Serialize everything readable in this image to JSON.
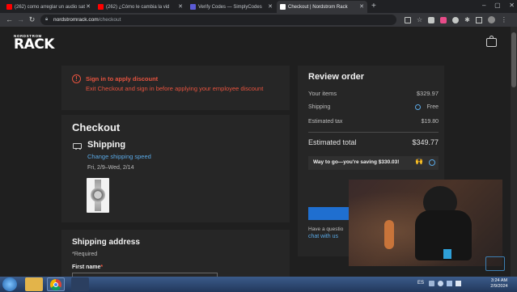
{
  "browser": {
    "tabs": [
      {
        "title": "(262) como arreglar un audio sat",
        "favicon_color": "#ff0000"
      },
      {
        "title": "(262) ¿Cómo le cambia la vid",
        "favicon_color": "#ff0000"
      },
      {
        "title": "Verify Codes — SimplyCodes",
        "favicon_color": "#5b5bd6"
      },
      {
        "title": "Checkout | Nordstrom Rack",
        "favicon_color": "#ffffff"
      }
    ],
    "url_host": "nordstromrack.com",
    "url_path": "/checkout",
    "new_tab_label": "+"
  },
  "header": {
    "logo_small": "NORDSTROM",
    "logo_big": "RACK"
  },
  "discount_notice": {
    "title": "Sign in to apply discount",
    "body": "Exit Checkout and sign in before applying your employee discount"
  },
  "checkout": {
    "heading": "Checkout",
    "shipping_title": "Shipping",
    "change_speed_link": "Change shipping speed",
    "delivery_window": "Fri, 2/9–Wed, 2/14"
  },
  "shipping_address": {
    "heading": "Shipping address",
    "required_note": "*Required",
    "first_name_label": "First name",
    "required_mark": "*"
  },
  "review": {
    "heading": "Review order",
    "items_label": "Your items",
    "items_value": "$329.97",
    "shipping_label": "Shipping",
    "shipping_value": "Free",
    "tax_label": "Estimated tax",
    "tax_value": "$19.80",
    "total_label": "Estimated total",
    "total_value": "$349.77",
    "savings_text": "Way to go—you're saving $330.03!",
    "savings_emoji": "🙌",
    "help_text": "Have a questio",
    "chat_link": "chat with us"
  },
  "taskbar": {
    "lang": "ES",
    "time": "3:24 AM",
    "date": "2/9/2024"
  },
  "colors": {
    "accent_red": "#e7533f",
    "link_blue": "#5aa9e6",
    "button_blue": "#1f6fd0"
  }
}
